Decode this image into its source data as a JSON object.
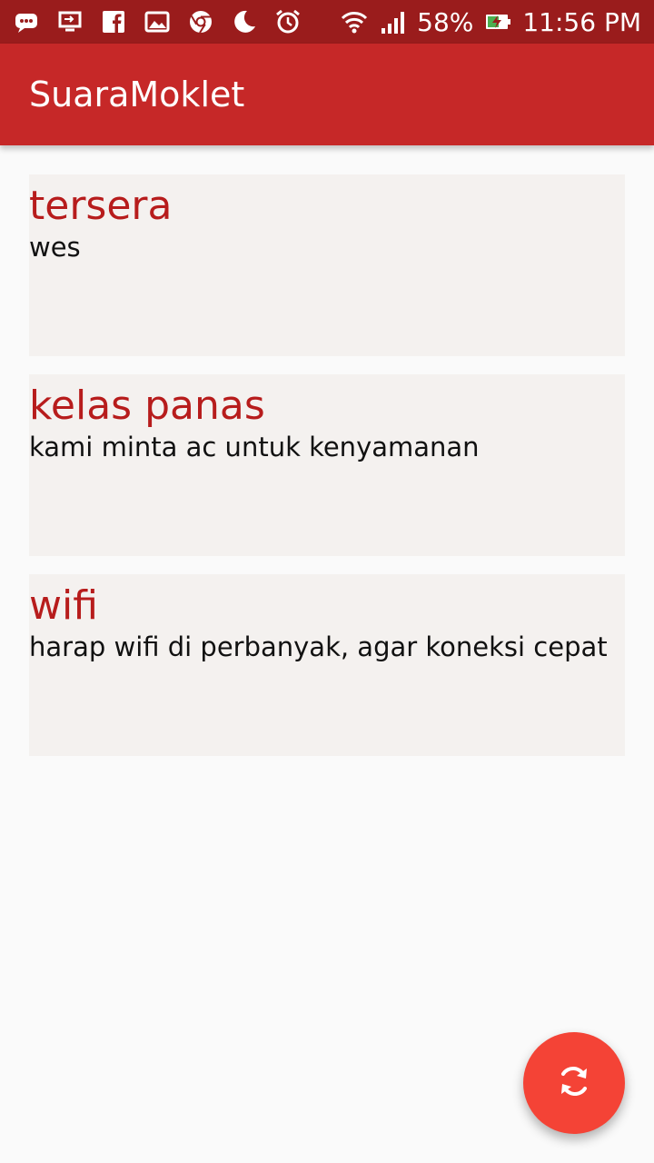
{
  "status_bar": {
    "battery": "58%",
    "time": "11:56 PM",
    "icons": [
      "chat-icon",
      "cast-icon",
      "facebook-icon",
      "gallery-icon",
      "chrome-icon",
      "moon-icon",
      "alarm-icon",
      "wifi-icon",
      "signal-icon",
      "battery-charging-icon"
    ]
  },
  "app_bar": {
    "title": "SuaraMoklet"
  },
  "cards": [
    {
      "title": "tersera",
      "body": "wes"
    },
    {
      "title": "kelas panas",
      "body": "kami minta ac untuk kenyamanan"
    },
    {
      "title": "wifi",
      "body": "harap wifi di perbanyak, agar koneksi cepat"
    }
  ],
  "fab": {
    "icon": "refresh-icon"
  },
  "colors": {
    "status_bar": "#9a1c1c",
    "app_bar": "#c62828",
    "card_title": "#b71c1c",
    "card_bg": "#f4f1ef",
    "fab": "#f44336"
  }
}
